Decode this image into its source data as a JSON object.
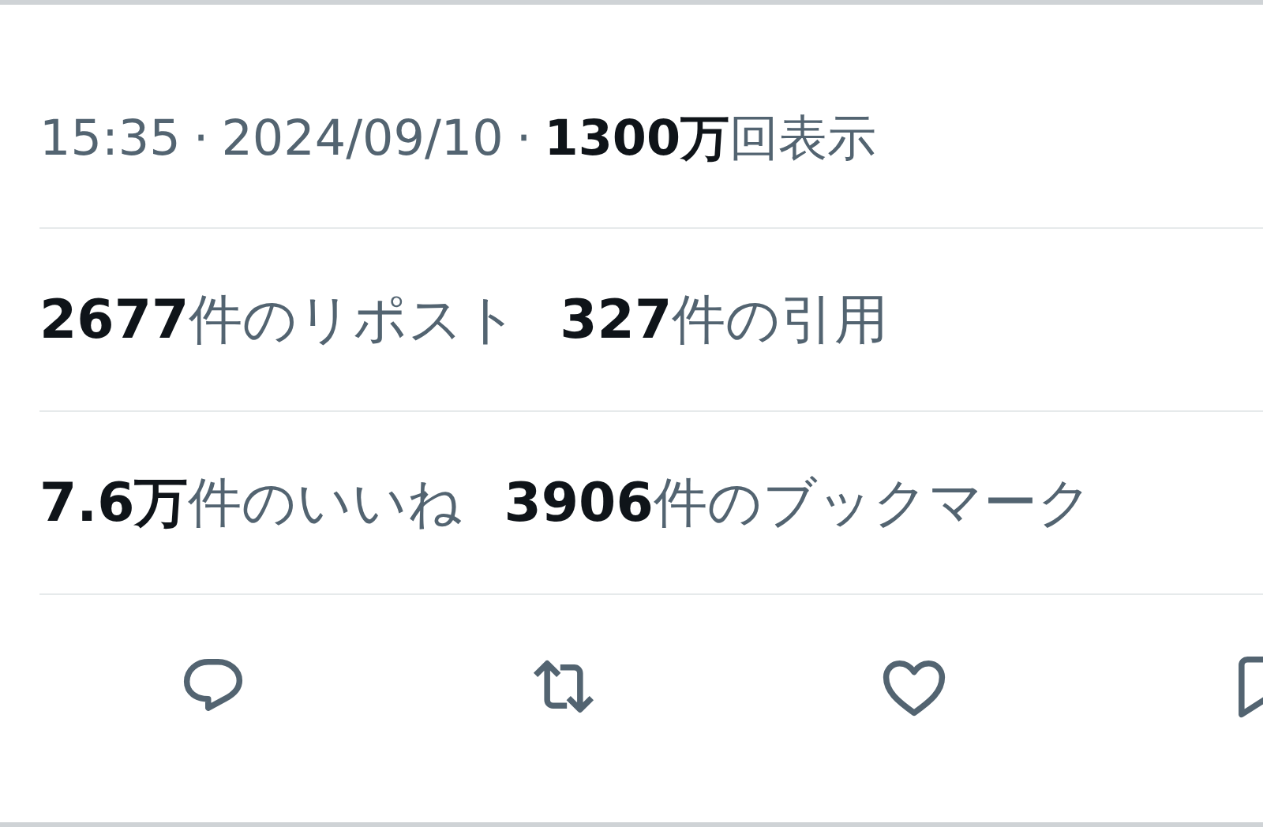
{
  "meta": {
    "time": "15:35",
    "separator_1": "·",
    "date": "2024/09/10",
    "separator_2": "·",
    "views_count": "1300万",
    "views_label": "回表示"
  },
  "stat_rows": [
    {
      "stats": [
        {
          "count": "2677",
          "label": "件のリポスト"
        },
        {
          "count": "327",
          "label": "件の引用"
        }
      ]
    },
    {
      "stats": [
        {
          "count": "7.6万",
          "label": "件のいいね"
        },
        {
          "count": "3906",
          "label": "件のブックマーク"
        }
      ]
    }
  ],
  "actions": [
    {
      "kind": "reply"
    },
    {
      "kind": "repost"
    },
    {
      "kind": "like"
    },
    {
      "kind": "bookmark"
    }
  ]
}
